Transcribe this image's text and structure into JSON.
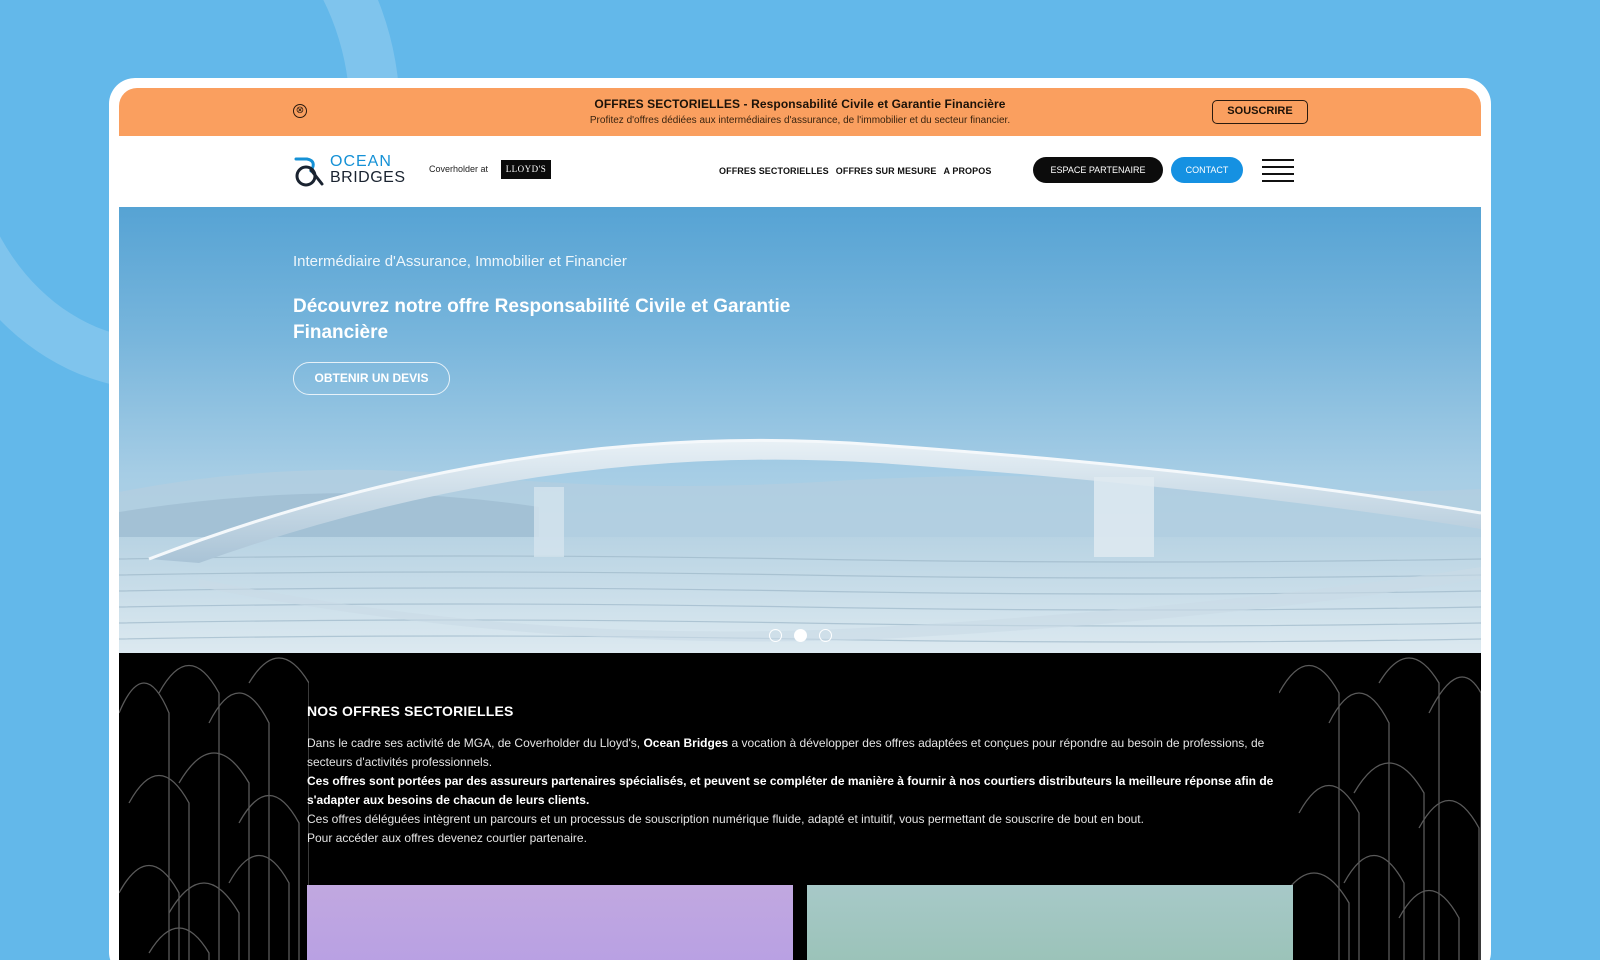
{
  "promo": {
    "title": "OFFRES SECTORIELLES - Responsabilité Civile et Garantie Financière",
    "subtitle": "Profitez d'offres dédiées aux intermédiaires d'assurance, de l'immobilier et du secteur financier.",
    "button": "SOUSCRIRE",
    "close_glyph": "⊗"
  },
  "header": {
    "logo_line1": "OCEAN",
    "logo_line2": "BRIDGES",
    "coverholder": "Coverholder at",
    "lloyds": "LLOYD'S",
    "nav": [
      "OFFRES SECTORIELLES",
      "OFFRES SUR MESURE",
      "A PROPOS"
    ],
    "partner_button": "ESPACE PARTENAIRE",
    "contact_button": "CONTACT"
  },
  "hero": {
    "kicker": "Intermédiaire d'Assurance, Immobilier et Financier",
    "title": "Découvrez notre offre Responsabilité Civile et Garantie Financière",
    "cta": "OBTENIR UN DEVIS",
    "slides_total": 3,
    "active_slide": 2
  },
  "offers": {
    "title": "NOS OFFRES SECTORIELLES",
    "p1_start": "Dans le cadre ses activité de MGA, de Coverholder du Lloyd's, ",
    "p1_bold": "Ocean Bridges",
    "p1_end": " a vocation à développer des offres adaptées et conçues pour répondre au besoin de professions, de secteurs d'activités professionnels.",
    "p2": "Ces offres sont portées par des assureurs partenaires spécialisés, et peuvent se compléter de manière à fournir à nos courtiers distributeurs la meilleure réponse afin de s'adapter aux besoins de chacun de leurs clients.",
    "p3": "Ces offres déléguées intègrent un parcours et un processus de souscription numérique fluide, adapté et intuitif, vous permettant de souscrire de bout en bout.",
    "p4": "Pour accéder aux offres devenez courtier partenaire."
  },
  "colors": {
    "page_bg": "#63b8ea",
    "promo_bg": "#fa9f5f",
    "brand_blue": "#1591e2",
    "dark": "#0c0c0c"
  }
}
